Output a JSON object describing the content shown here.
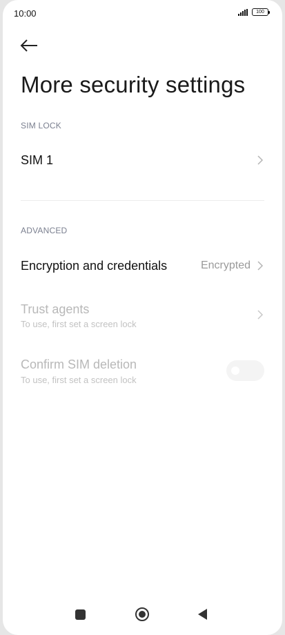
{
  "status_bar": {
    "time": "10:00",
    "battery": "100",
    "signal_icon": "signal-bars-icon"
  },
  "header": {
    "back_icon": "back-arrow-icon",
    "title": "More security settings"
  },
  "sections": [
    {
      "header": "SIM LOCK",
      "items": [
        {
          "title": "SIM 1",
          "type": "navigation",
          "enabled": true
        }
      ]
    },
    {
      "header": "ADVANCED",
      "items": [
        {
          "title": "Encryption and credentials",
          "value": "Encrypted",
          "type": "navigation",
          "enabled": true
        },
        {
          "title": "Trust agents",
          "subtitle": "To use, first set a screen lock",
          "type": "navigation",
          "enabled": false
        },
        {
          "title": "Confirm SIM deletion",
          "subtitle": "To use, first set a screen lock",
          "type": "toggle",
          "checked": false,
          "enabled": false
        }
      ]
    }
  ],
  "nav_bar": {
    "recent_icon": "recent-apps-icon",
    "home_icon": "home-icon",
    "back_icon": "back-triangle-icon"
  },
  "colors": {
    "background": "#ffffff",
    "primary_text": "#111111",
    "disabled_text": "#b8b8b8",
    "section_header": "#7a7f8f",
    "secondary_value": "#9a9a9a"
  }
}
